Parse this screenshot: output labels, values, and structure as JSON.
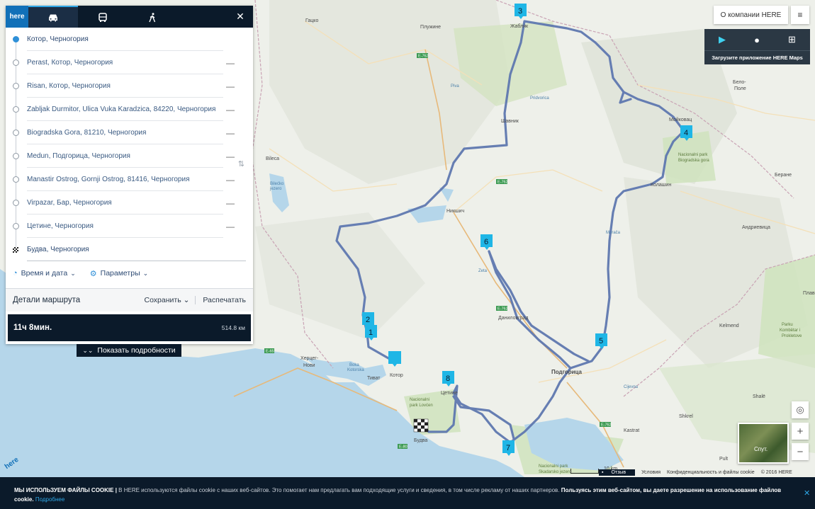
{
  "app": {
    "logo": "here"
  },
  "panel": {
    "close": "✕",
    "waypoints": [
      {
        "label": "Котор, Черногория",
        "type": "start"
      },
      {
        "label": "Perast, Котор, Черногория",
        "type": "via"
      },
      {
        "label": "Risan, Котор, Черногория",
        "type": "via"
      },
      {
        "label": "Zabljak Durmitor, Ulica Vuka Karadzica, 84220, Черногория",
        "type": "via"
      },
      {
        "label": "Biogradska Gora, 81210, Черногория",
        "type": "via"
      },
      {
        "label": "Medun, Подгорица, Черногория",
        "type": "via"
      },
      {
        "label": "Manastir Ostrog, Gornji Ostrog, 81416, Черногория",
        "type": "via"
      },
      {
        "label": "Virpazar, Бар, Черногория",
        "type": "via"
      },
      {
        "label": "Цетине, Черногория",
        "type": "via"
      },
      {
        "label": "Будва, Черногория",
        "type": "finish"
      }
    ],
    "remove_symbol": "—",
    "time_date": "Время и дата",
    "parameters": "Параметры",
    "details_title": "Детали маршрута",
    "save": "Сохранить",
    "print": "Распечатать",
    "duration": "11ч 8мин.",
    "distance": "514.8 км",
    "show_details": "Показать подробности"
  },
  "top_right": {
    "about": "О компании HERE",
    "menu_icon": "≡",
    "app_download": "Загрузите приложение HERE Maps"
  },
  "map": {
    "cities": [
      {
        "name": "Гацко"
      },
      {
        "name": "Плужине"
      },
      {
        "name": "Жабляк"
      },
      {
        "name": "Бело-Поле"
      },
      {
        "name": "Мойковац"
      },
      {
        "name": "Bileca"
      },
      {
        "name": "Шавник"
      },
      {
        "name": "Колашин"
      },
      {
        "name": "Беране"
      },
      {
        "name": "Никшич"
      },
      {
        "name": "Андриевица"
      },
      {
        "name": "Даниловград"
      },
      {
        "name": "Херцег-Нови"
      },
      {
        "name": "Котор"
      },
      {
        "name": "Тиват"
      },
      {
        "name": "Подгорица"
      },
      {
        "name": "Цетине"
      },
      {
        "name": "Будва"
      },
      {
        "name": "Kastrat"
      },
      {
        "name": "Shkrel"
      },
      {
        "name": "Kelmend"
      },
      {
        "name": "Плав"
      },
      {
        "name": "Pult"
      },
      {
        "name": "Shalë"
      }
    ],
    "water_labels": [
      "Bilećko jezero",
      "Boka Kotorska",
      "Skadarsko jezero"
    ],
    "park_labels": [
      "Nacionalni park Biogradska gora",
      "Nacionalni park Lovćen",
      "Nacionalni park Skadarsko jezero",
      "Parku Kombëtar i Prokletove"
    ],
    "river_labels": [
      "Piva",
      "Pridvorica",
      "Morača",
      "Zeta",
      "Cijevna"
    ],
    "road_labels": [
      "E-762",
      "E-80",
      "E-762",
      "E-65",
      "E-762",
      "E-80"
    ],
    "markers": [
      "1",
      "2",
      "3",
      "4",
      "5",
      "6",
      "7",
      "8"
    ],
    "scale_label": "10 km",
    "thumbnail_label": "Спут."
  },
  "footer": {
    "feedback": "Отзыв",
    "terms": "Условия",
    "privacy": "Конфиденциальность и файлы cookie",
    "copyright": "© 2016 HERE"
  },
  "cookie": {
    "title": "МЫ ИСПОЛЬЗУЕМ ФАЙЛЫ COOKIE |",
    "text": "В HERE используются файлы cookie с наших веб-сайтов. Это помогает нам предлагать вам подходящие услуги и сведения, в том числе рекламу от наших партнеров.",
    "consent": "Пользуясь этим веб-сайтом, вы даете разрешение на использование файлов cookie.",
    "more": "Подробнее",
    "close": "✕"
  },
  "colors": {
    "route": "#5f78b0",
    "marker": "#1fb6e6",
    "panel_dark": "#0b1a2a",
    "accent": "#2ea7e6",
    "sea": "#b5d6ea",
    "park": "#d3e4c1"
  }
}
